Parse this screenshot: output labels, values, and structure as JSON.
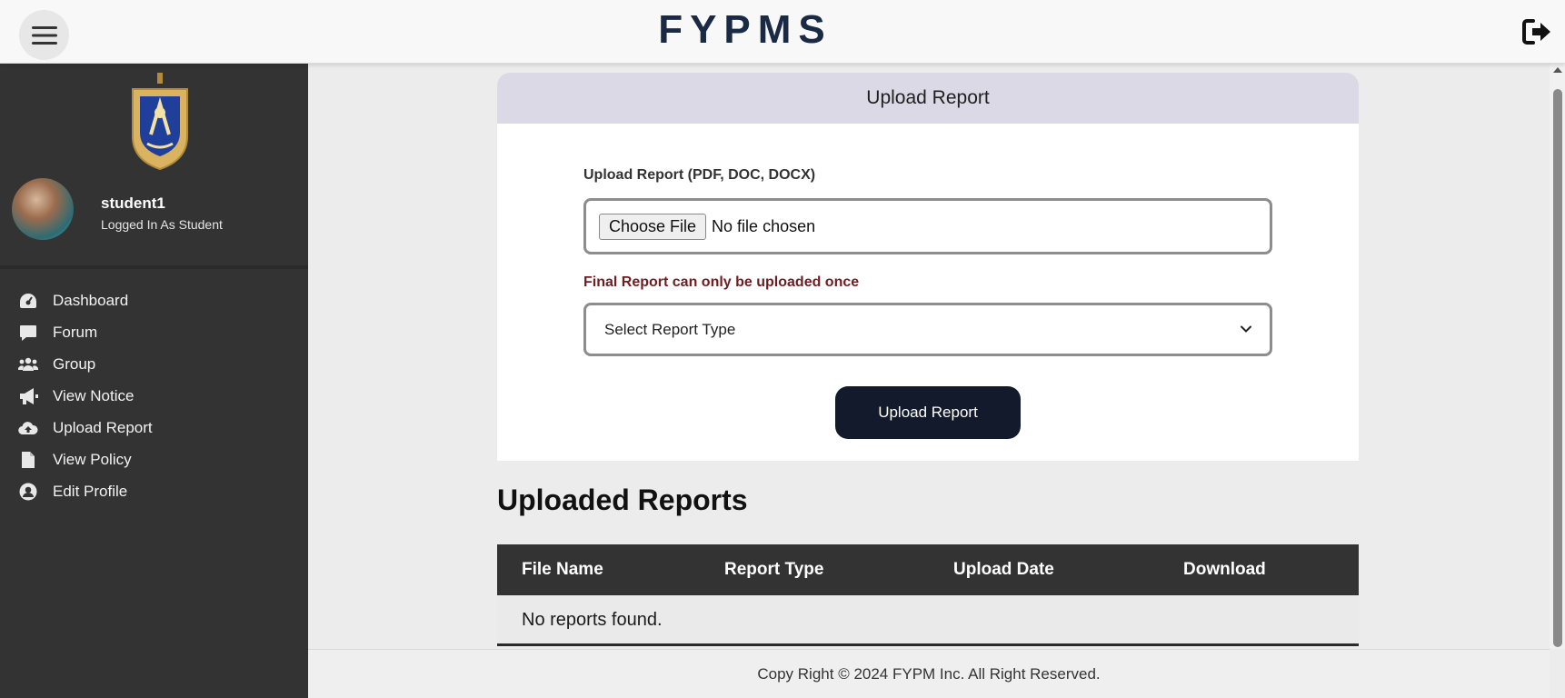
{
  "header": {
    "brand": "FYPMS"
  },
  "sidebar": {
    "username": "student1",
    "role": "Logged In As Student",
    "items": [
      {
        "label": "Dashboard",
        "icon": "dashboard-icon"
      },
      {
        "label": "Forum",
        "icon": "comment-icon"
      },
      {
        "label": "Group",
        "icon": "users-icon"
      },
      {
        "label": "View Notice",
        "icon": "bullhorn-icon"
      },
      {
        "label": "Upload Report",
        "icon": "cloud-upload-icon"
      },
      {
        "label": "View Policy",
        "icon": "file-icon"
      },
      {
        "label": "Edit Profile",
        "icon": "user-circle-icon"
      }
    ]
  },
  "upload_card": {
    "title": "Upload Report",
    "file_label": "Upload Report (PDF, DOC, DOCX)",
    "choose_file": "Choose File",
    "no_file": "No file chosen",
    "warning": "Final Report can only be uploaded once",
    "select_placeholder": "Select Report Type",
    "submit": "Upload Report"
  },
  "reports": {
    "title": "Uploaded Reports",
    "columns": [
      "File Name",
      "Report Type",
      "Upload Date",
      "Download"
    ],
    "empty": "No reports found."
  },
  "footer": {
    "text": "Copy Right © 2024 FYPM Inc. All Right Reserved."
  },
  "colors": {
    "sidebar": "#333333",
    "brand": "#1b2a44",
    "button": "#121a2b",
    "warning": "#6b1f22",
    "card_header": "#dcd9e6"
  }
}
